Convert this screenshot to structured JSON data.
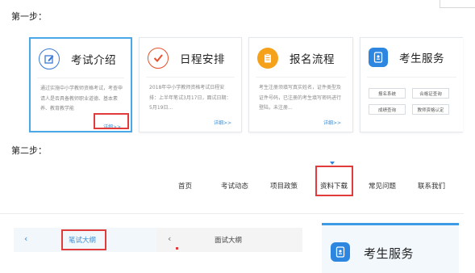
{
  "steps": {
    "step1": "第一步：",
    "step2": "第二步："
  },
  "cards": [
    {
      "title": "考试介绍",
      "icon": "edit-icon",
      "desc": "通过实施中小学教师资格考试，考查申请人是否具备教师职业道德、基本素养、教育教学能",
      "more": "详细>>"
    },
    {
      "title": "日程安排",
      "icon": "checkmark-icon",
      "desc": "2018年中小学教师资格考试日程安排：上半年笔试3月17日，面试日期：5月19日...",
      "more": "详细>>"
    },
    {
      "title": "报名流程",
      "icon": "clipboard-icon",
      "desc": "考生注册须填写真实姓名，证件类型及证件号码，已注册的考生填写密码进行登陆，未注册...",
      "more": "详细>>"
    },
    {
      "title": "考生服务",
      "icon": "id-card-icon",
      "buttons": [
        "报名系统",
        "合格证查询",
        "成绩查询",
        "教师资格认定"
      ]
    }
  ],
  "nav": {
    "items": [
      "首页",
      "考试动态",
      "项目政策",
      "资料下载",
      "常见问题",
      "联系我们"
    ]
  },
  "tabs": {
    "left_label": "笔试大纲",
    "right_label": "面试大纲",
    "arrow": "‹"
  },
  "service": {
    "title": "考生服务",
    "icon": "id-card-icon"
  },
  "colors": {
    "accent": "#3c9be6",
    "highlight": "#e23b3b",
    "card_edit": "#3b79d4",
    "card_check": "#e8502d",
    "card_clip": "#f5a11a",
    "card_id": "#2d87e0"
  }
}
